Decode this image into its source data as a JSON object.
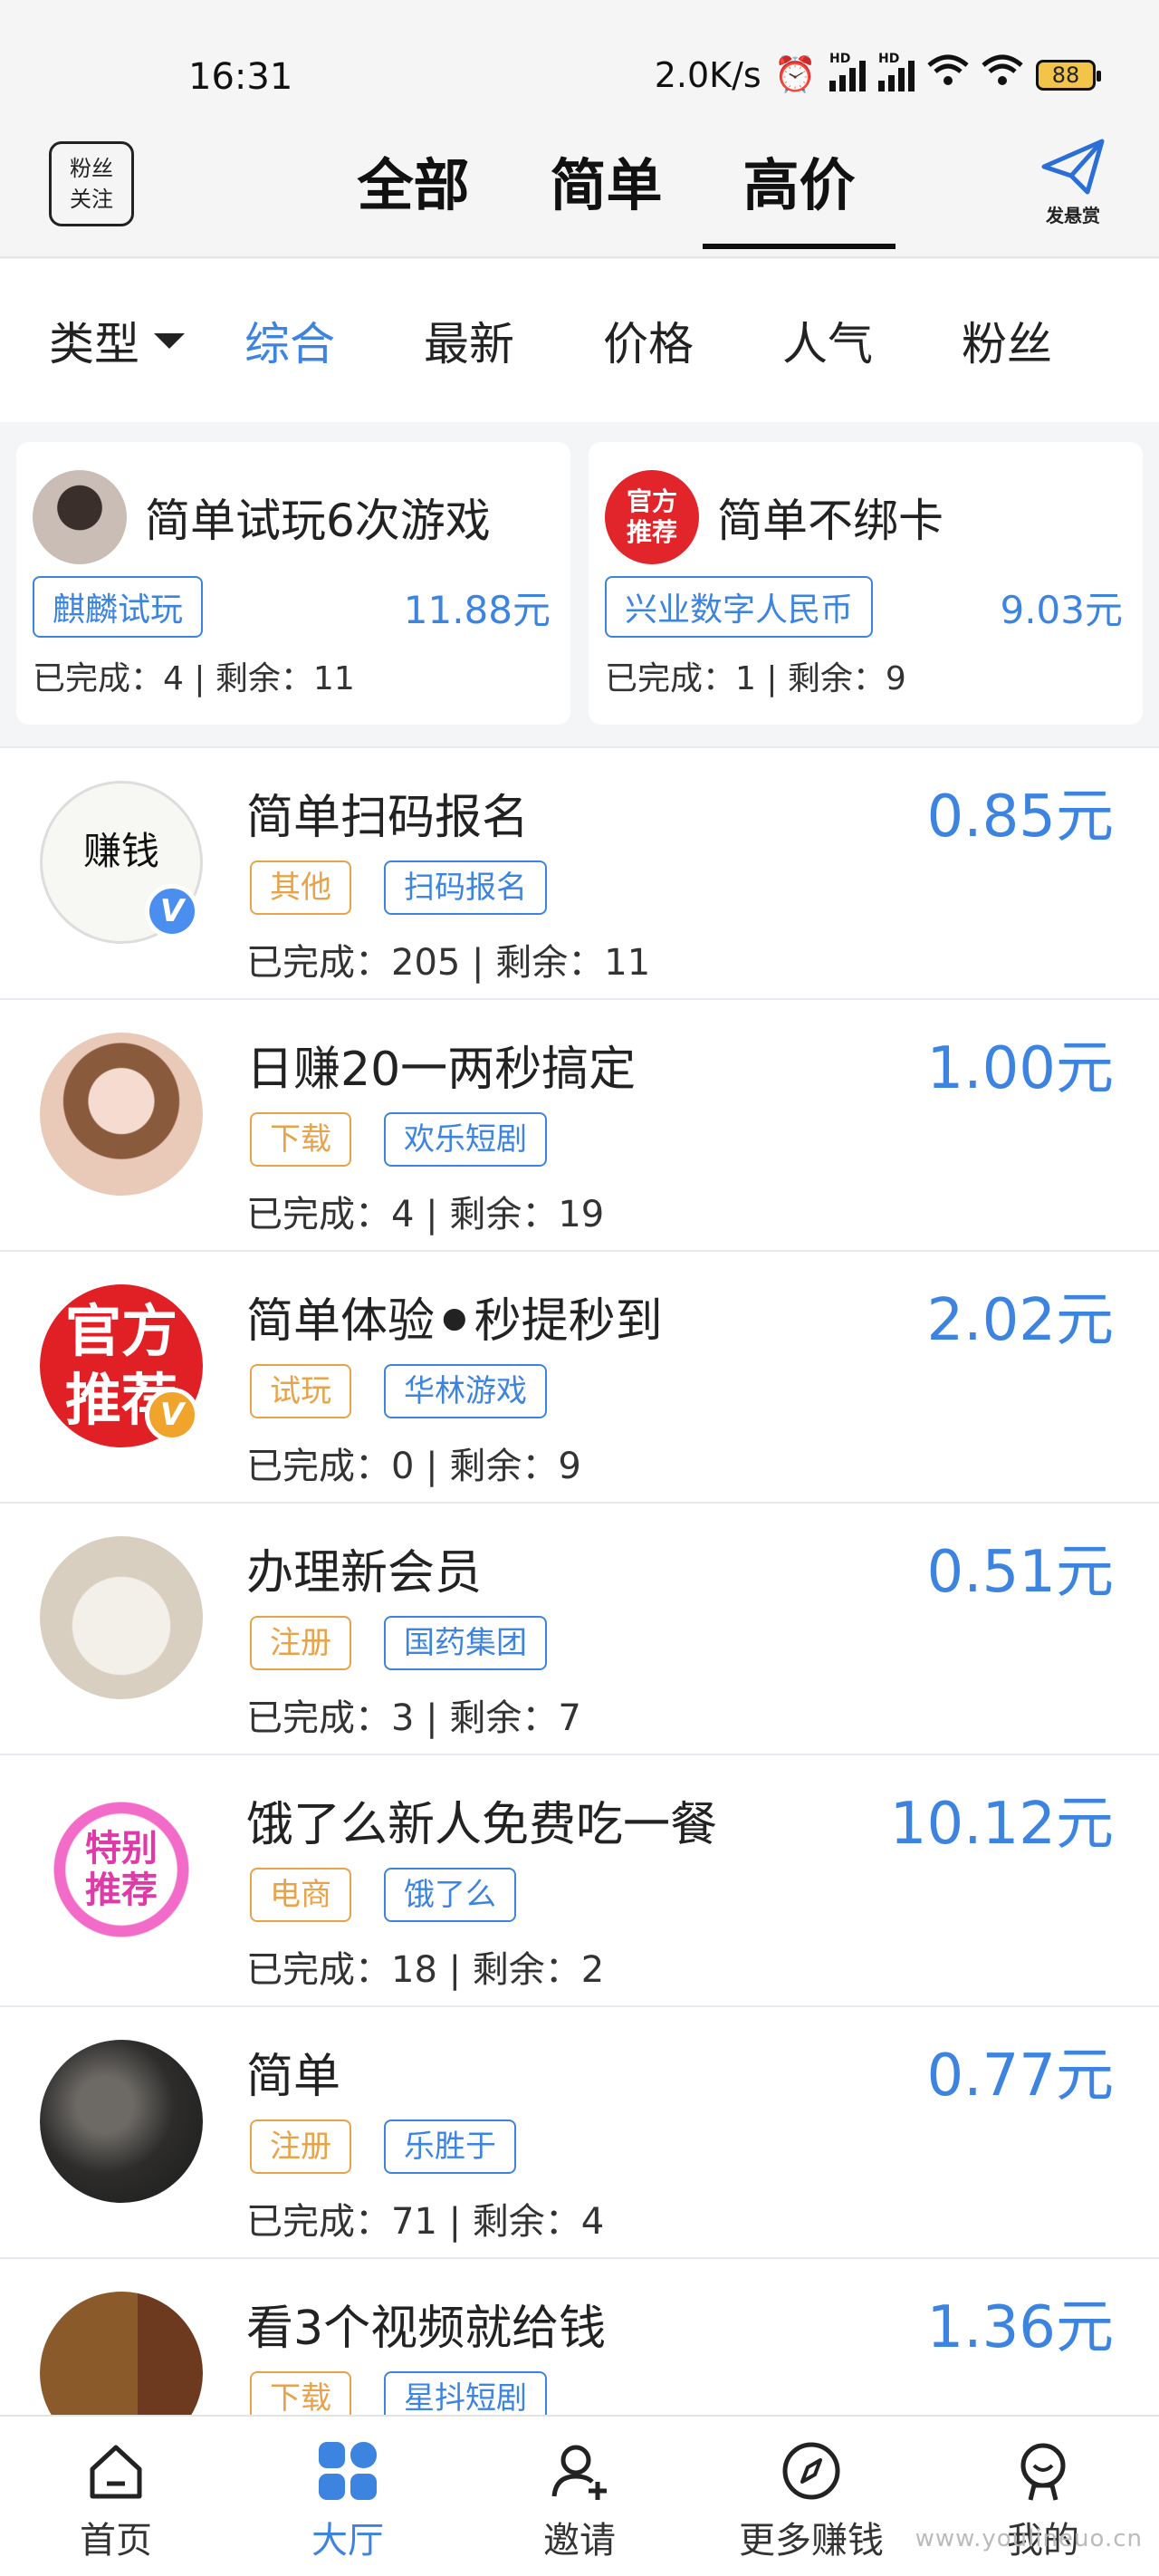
{
  "status_bar": {
    "time": "16:31",
    "net_speed": "2.0K/s",
    "battery": "88"
  },
  "header": {
    "fans_button": [
      "粉丝",
      "关注"
    ],
    "tabs": [
      "全部",
      "简单",
      "高价"
    ],
    "active_tab": "高价",
    "send_label": "发悬赏"
  },
  "filter": {
    "type_label": "类型",
    "items": [
      "综合",
      "最新",
      "价格",
      "人气",
      "粉丝"
    ],
    "active": "综合"
  },
  "featured": [
    {
      "title": "简单试玩6次游戏",
      "tag": "麒麟试玩",
      "price": "11.88元",
      "stats": "已完成：4 | 剩余：11",
      "avatar_text": []
    },
    {
      "title": "简单不绑卡",
      "tag": "兴业数字人民币",
      "price": "9.03元",
      "stats": "已完成：1 | 剩余：9",
      "avatar_text": [
        "官方",
        "推荐"
      ]
    }
  ],
  "tasks": [
    {
      "title": "简单扫码报名",
      "price": "0.85元",
      "category": "其他",
      "platform": "扫码报名",
      "stats": "已完成：205 | 剩余：11",
      "avatar_text": "赚钱",
      "verified": "V"
    },
    {
      "title": "日赚20一两秒搞定",
      "price": "1.00元",
      "category": "下载",
      "platform": "欢乐短剧",
      "stats": "已完成：4 | 剩余：19"
    },
    {
      "title": "简单体验⚫秒提秒到",
      "price": "2.02元",
      "category": "试玩",
      "platform": "华林游戏",
      "stats": "已完成：0 | 剩余：9",
      "avatar_text": [
        "官方",
        "推荐"
      ],
      "verified": "V"
    },
    {
      "title": "办理新会员",
      "price": "0.51元",
      "category": "注册",
      "platform": "国药集团",
      "stats": "已完成：3 | 剩余：7"
    },
    {
      "title": "饿了么新人免费吃一餐",
      "price": "10.12元",
      "category": "电商",
      "platform": "饿了么",
      "stats": "已完成：18 | 剩余：2",
      "avatar_text": [
        "特别",
        "推荐"
      ]
    },
    {
      "title": "简单",
      "price": "0.77元",
      "category": "注册",
      "platform": "乐胜于",
      "stats": "已完成：71 | 剩余：4"
    },
    {
      "title": "看3个视频就给钱",
      "price": "1.36元",
      "category": "下载",
      "platform": "星抖短剧",
      "stats": ""
    }
  ],
  "bottom_nav": [
    {
      "label": "首页",
      "icon": "home-icon"
    },
    {
      "label": "大厅",
      "icon": "grid-icon"
    },
    {
      "label": "邀请",
      "icon": "add-user-icon"
    },
    {
      "label": "更多赚钱",
      "icon": "compass-icon"
    },
    {
      "label": "我的",
      "icon": "profile-icon"
    }
  ],
  "active_nav": "大厅",
  "watermark": "www.youlineuo.cn",
  "colors": {
    "accent": "#3d84e0",
    "category_tag": "#e8a34a"
  }
}
